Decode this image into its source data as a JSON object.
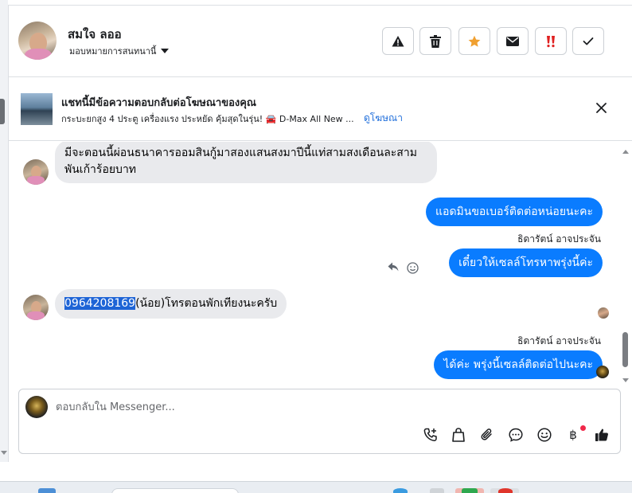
{
  "header": {
    "contact_name": "สมใจ ลออ",
    "assign_label": "มอบหมายการสนทนานี้"
  },
  "ad": {
    "title": "แชทนี้มีข้อความตอบกลับต่อโฆษณาของคุณ",
    "description": "กระบะยกสูง 4 ประตู เครื่องแรง ประหยัด คุ้มสุดในรุ่น! 🚘 D-Max All New ...",
    "link_label": "ดูโฆษณา"
  },
  "messages": {
    "m1": "มีจะตอนนี้ผ่อนธนาคารออมสินกู้มาสองแสนสงมาปีนี้แท่สามสงเดือนละสามพันเก้าร้อยบาท",
    "m2": "แอดมินขอเบอร์ติดต่อหน่อยนะคะ",
    "sender_1": "ธิดารัตน์ อาจประจัน",
    "m3": "เดี๋ยวให้เซลล์โทรหาพรุ่งนี้ค่ะ",
    "m4_phone": "0964208169",
    "m4_text": "(น้อย)โทรตอนพักเทียงนะครับ",
    "sender_2": "ธิดารัตน์ อาจประจัน",
    "m5": "ได้ค่ะ พรุ่งนี้เซลล์ติดต่อไปนะคะ"
  },
  "composer": {
    "placeholder": "ตอบกลับใน Messenger..."
  },
  "colors": {
    "outgoing_bubble": "#0a7cff",
    "incoming_bubble": "#e9eaed",
    "link": "#216fdb",
    "star": "#f0a030",
    "important": "#e02020"
  }
}
